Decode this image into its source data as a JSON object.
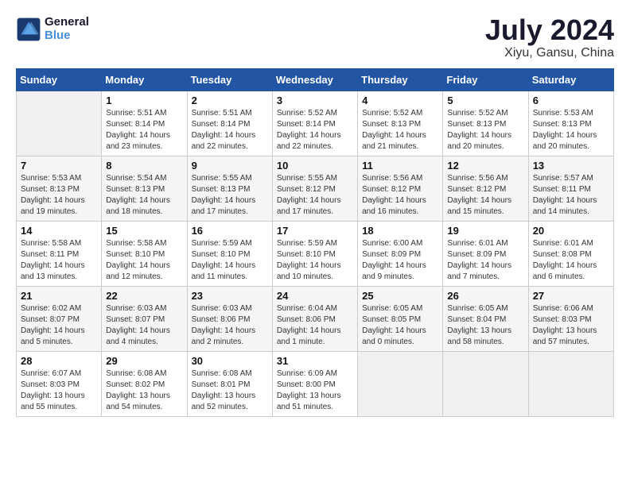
{
  "header": {
    "logo_line1": "General",
    "logo_line2": "Blue",
    "month": "July 2024",
    "location": "Xiyu, Gansu, China"
  },
  "days_of_week": [
    "Sunday",
    "Monday",
    "Tuesday",
    "Wednesday",
    "Thursday",
    "Friday",
    "Saturday"
  ],
  "weeks": [
    [
      {
        "day": "",
        "info": ""
      },
      {
        "day": "1",
        "info": "Sunrise: 5:51 AM\nSunset: 8:14 PM\nDaylight: 14 hours\nand 23 minutes."
      },
      {
        "day": "2",
        "info": "Sunrise: 5:51 AM\nSunset: 8:14 PM\nDaylight: 14 hours\nand 22 minutes."
      },
      {
        "day": "3",
        "info": "Sunrise: 5:52 AM\nSunset: 8:14 PM\nDaylight: 14 hours\nand 22 minutes."
      },
      {
        "day": "4",
        "info": "Sunrise: 5:52 AM\nSunset: 8:13 PM\nDaylight: 14 hours\nand 21 minutes."
      },
      {
        "day": "5",
        "info": "Sunrise: 5:52 AM\nSunset: 8:13 PM\nDaylight: 14 hours\nand 20 minutes."
      },
      {
        "day": "6",
        "info": "Sunrise: 5:53 AM\nSunset: 8:13 PM\nDaylight: 14 hours\nand 20 minutes."
      }
    ],
    [
      {
        "day": "7",
        "info": "Sunrise: 5:53 AM\nSunset: 8:13 PM\nDaylight: 14 hours\nand 19 minutes."
      },
      {
        "day": "8",
        "info": "Sunrise: 5:54 AM\nSunset: 8:13 PM\nDaylight: 14 hours\nand 18 minutes."
      },
      {
        "day": "9",
        "info": "Sunrise: 5:55 AM\nSunset: 8:13 PM\nDaylight: 14 hours\nand 17 minutes."
      },
      {
        "day": "10",
        "info": "Sunrise: 5:55 AM\nSunset: 8:12 PM\nDaylight: 14 hours\nand 17 minutes."
      },
      {
        "day": "11",
        "info": "Sunrise: 5:56 AM\nSunset: 8:12 PM\nDaylight: 14 hours\nand 16 minutes."
      },
      {
        "day": "12",
        "info": "Sunrise: 5:56 AM\nSunset: 8:12 PM\nDaylight: 14 hours\nand 15 minutes."
      },
      {
        "day": "13",
        "info": "Sunrise: 5:57 AM\nSunset: 8:11 PM\nDaylight: 14 hours\nand 14 minutes."
      }
    ],
    [
      {
        "day": "14",
        "info": "Sunrise: 5:58 AM\nSunset: 8:11 PM\nDaylight: 14 hours\nand 13 minutes."
      },
      {
        "day": "15",
        "info": "Sunrise: 5:58 AM\nSunset: 8:10 PM\nDaylight: 14 hours\nand 12 minutes."
      },
      {
        "day": "16",
        "info": "Sunrise: 5:59 AM\nSunset: 8:10 PM\nDaylight: 14 hours\nand 11 minutes."
      },
      {
        "day": "17",
        "info": "Sunrise: 5:59 AM\nSunset: 8:10 PM\nDaylight: 14 hours\nand 10 minutes."
      },
      {
        "day": "18",
        "info": "Sunrise: 6:00 AM\nSunset: 8:09 PM\nDaylight: 14 hours\nand 9 minutes."
      },
      {
        "day": "19",
        "info": "Sunrise: 6:01 AM\nSunset: 8:09 PM\nDaylight: 14 hours\nand 7 minutes."
      },
      {
        "day": "20",
        "info": "Sunrise: 6:01 AM\nSunset: 8:08 PM\nDaylight: 14 hours\nand 6 minutes."
      }
    ],
    [
      {
        "day": "21",
        "info": "Sunrise: 6:02 AM\nSunset: 8:07 PM\nDaylight: 14 hours\nand 5 minutes."
      },
      {
        "day": "22",
        "info": "Sunrise: 6:03 AM\nSunset: 8:07 PM\nDaylight: 14 hours\nand 4 minutes."
      },
      {
        "day": "23",
        "info": "Sunrise: 6:03 AM\nSunset: 8:06 PM\nDaylight: 14 hours\nand 2 minutes."
      },
      {
        "day": "24",
        "info": "Sunrise: 6:04 AM\nSunset: 8:06 PM\nDaylight: 14 hours\nand 1 minute."
      },
      {
        "day": "25",
        "info": "Sunrise: 6:05 AM\nSunset: 8:05 PM\nDaylight: 14 hours\nand 0 minutes."
      },
      {
        "day": "26",
        "info": "Sunrise: 6:05 AM\nSunset: 8:04 PM\nDaylight: 13 hours\nand 58 minutes."
      },
      {
        "day": "27",
        "info": "Sunrise: 6:06 AM\nSunset: 8:03 PM\nDaylight: 13 hours\nand 57 minutes."
      }
    ],
    [
      {
        "day": "28",
        "info": "Sunrise: 6:07 AM\nSunset: 8:03 PM\nDaylight: 13 hours\nand 55 minutes."
      },
      {
        "day": "29",
        "info": "Sunrise: 6:08 AM\nSunset: 8:02 PM\nDaylight: 13 hours\nand 54 minutes."
      },
      {
        "day": "30",
        "info": "Sunrise: 6:08 AM\nSunset: 8:01 PM\nDaylight: 13 hours\nand 52 minutes."
      },
      {
        "day": "31",
        "info": "Sunrise: 6:09 AM\nSunset: 8:00 PM\nDaylight: 13 hours\nand 51 minutes."
      },
      {
        "day": "",
        "info": ""
      },
      {
        "day": "",
        "info": ""
      },
      {
        "day": "",
        "info": ""
      }
    ]
  ]
}
